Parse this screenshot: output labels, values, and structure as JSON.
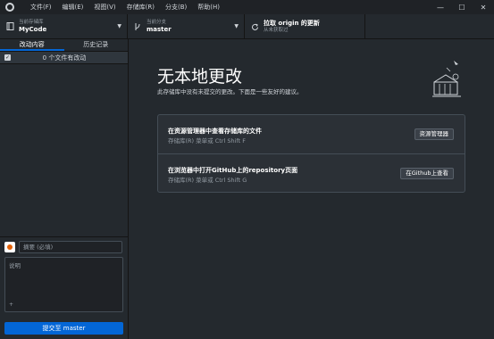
{
  "menu": [
    "文件(F)",
    "编辑(E)",
    "视图(V)",
    "存储库(R)",
    "分支(B)",
    "帮助(H)"
  ],
  "window_controls": {
    "minimize": "—",
    "maximize": "☐",
    "close": "✕"
  },
  "toolbar": {
    "repo_label": "当前存储库",
    "repo_value": "MyCode",
    "branch_label": "当前分支",
    "branch_value": "master",
    "fetch_label": "拉取 origin 的更新",
    "fetch_value": "从未获取过"
  },
  "tabs": {
    "changes": "改动内容",
    "history": "历史记录"
  },
  "changes": {
    "count_text": "0 个文件有改动"
  },
  "commit": {
    "summary_placeholder": "摘要 (必填)",
    "description_placeholder": "说明",
    "coauthor_icon": "+",
    "button_label": "提交至 master"
  },
  "main": {
    "title": "无本地更改",
    "subtitle": "此存储库中没有未提交的更改。下面是一些友好的建议。",
    "suggestions": [
      {
        "title": "在资源管理器中查看存储库的文件",
        "desc": "存储库(R) 菜单或  Ctrl  Shift  F",
        "button": "资源管理器"
      },
      {
        "title": "在浏览器中打开GitHub上的repository页面",
        "desc": "存储库(R) 菜单或  Ctrl  Shift  G",
        "button": "在Github上查看"
      }
    ]
  },
  "icons": {
    "app": "github-logo-icon",
    "repo": "repo-icon",
    "branch": "branch-icon",
    "fetch": "sync-icon",
    "dropdown": "chevron-down-icon"
  },
  "colors": {
    "accent": "#0366d6",
    "background": "#24292e",
    "titlebar": "#1f2226"
  }
}
